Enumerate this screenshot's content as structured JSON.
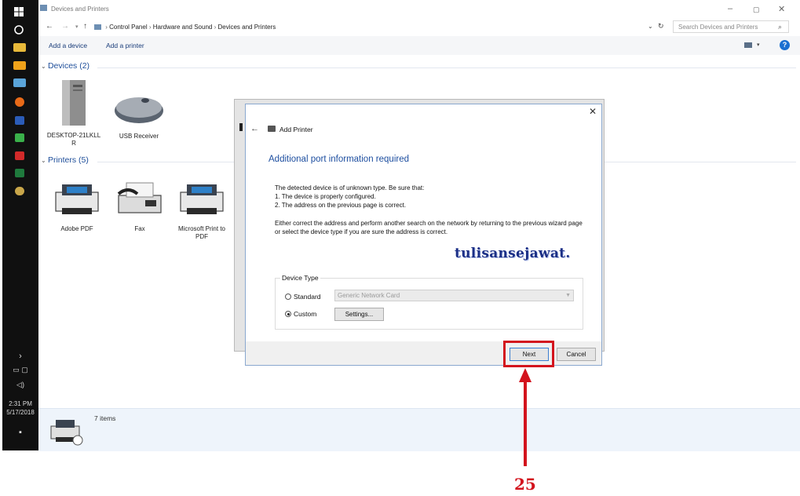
{
  "taskbar": {
    "clock_time": "2:31 PM",
    "clock_date": "5/17/2018",
    "icons": [
      "windows-logo-icon",
      "cortana-icon",
      "file-explorer-icon",
      "media-icon",
      "control-panel-icon",
      "firefox-icon",
      "word-icon",
      "green-app-icon",
      "red-app-icon",
      "excel-icon",
      "paint-icon"
    ]
  },
  "window": {
    "title": "Devices and Printers",
    "breadcrumbs": [
      "Control Panel",
      "Hardware and Sound",
      "Devices and Printers"
    ],
    "search_placeholder": "Search Devices and Printers",
    "toolbar": {
      "add_device": "Add a device",
      "add_printer": "Add a printer"
    },
    "help": "?"
  },
  "devices_group": {
    "header": "Devices (2)",
    "items": [
      {
        "label": "DESKTOP-21LKLL R"
      },
      {
        "label": "USB Receiver"
      }
    ]
  },
  "printers_group": {
    "header": "Printers (5)",
    "items": [
      {
        "label": "Adobe PDF"
      },
      {
        "label": "Fax"
      },
      {
        "label": "Microsoft Print to PDF"
      }
    ]
  },
  "status": {
    "items_count": "7 items"
  },
  "dialog": {
    "title": "Add Printer",
    "heading": "Additional port information required",
    "lines": [
      "The detected device is of unknown type.  Be sure that:",
      "1. The device is properly configured.",
      "2.  The address on the previous page is correct."
    ],
    "para2": "Either correct the address and perform another search on the network by returning to the previous wizard page or select the device type if you are sure the address is correct.",
    "device_type": {
      "legend": "Device Type",
      "standard_label": "Standard",
      "standard_value": "Generic Network Card",
      "custom_label": "Custom",
      "settings_button": "Settings...",
      "selected": "custom"
    },
    "next_button": "Next",
    "cancel_button": "Cancel"
  },
  "watermark": "tulisansejawat.",
  "annotation": {
    "step_number": "25",
    "color": "#d3131d"
  }
}
